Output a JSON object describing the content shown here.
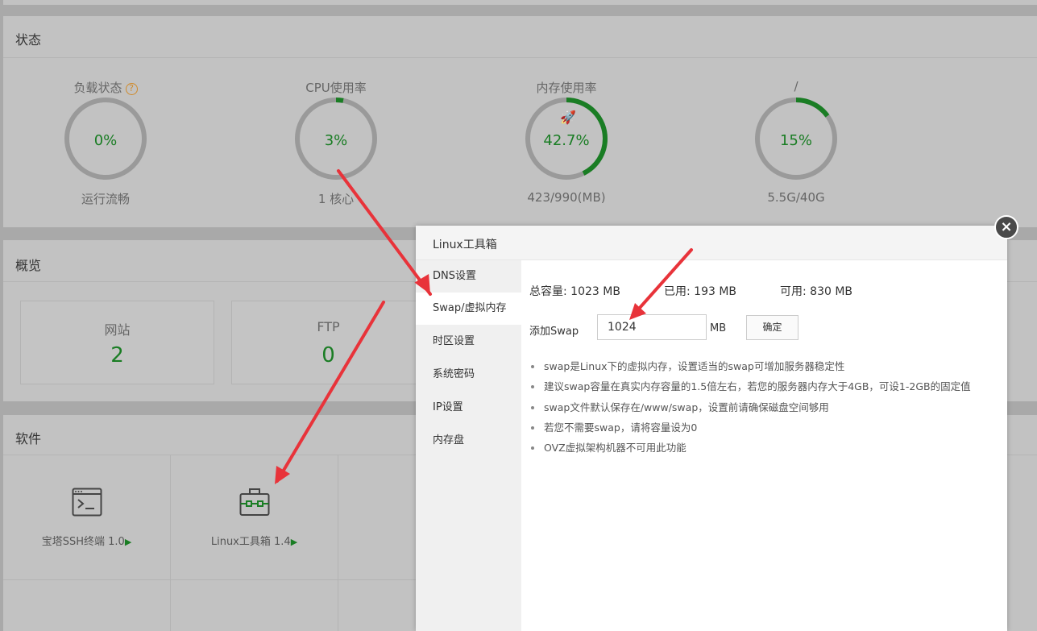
{
  "status_panel": {
    "title": "状态",
    "gauges": [
      {
        "title": "负载状态",
        "value": "0%",
        "sub": "运行流畅",
        "percent": 0,
        "has_help": true
      },
      {
        "title": "CPU使用率",
        "value": "3%",
        "sub": "1 核心",
        "percent": 3
      },
      {
        "title": "内存使用率",
        "value": "42.7%",
        "sub": "423/990(MB)",
        "percent": 42.7,
        "icon": "rocket-icon"
      },
      {
        "title": "/",
        "value": "15%",
        "sub": "5.5G/40G",
        "percent": 15
      }
    ],
    "help_symbol": "?"
  },
  "overview_panel": {
    "title": "概览",
    "cards": [
      {
        "label": "网站",
        "value": "2"
      },
      {
        "label": "FTP",
        "value": "0"
      }
    ]
  },
  "software_panel": {
    "title": "软件",
    "items": [
      {
        "label": "宝塔SSH终端 1.0",
        "icon": "terminal-icon"
      },
      {
        "label": "Linux工具箱 1.4",
        "icon": "toolbox-icon"
      }
    ],
    "play_symbol": "▶"
  },
  "dialog": {
    "title": "Linux工具箱",
    "close_symbol": "×",
    "nav": [
      "DNS设置",
      "Swap/虚拟内存",
      "时区设置",
      "系统密码",
      "IP设置",
      "内存盘"
    ],
    "active_nav": "Swap/虚拟内存",
    "stats": {
      "total": "总容量:  1023 MB",
      "used": "已用:  193 MB",
      "free": "可用:  830 MB"
    },
    "add_swap_label": "添加Swap",
    "swap_value": "1024",
    "unit": "MB",
    "confirm_label": "确定",
    "tips": [
      "swap是Linux下的虚拟内存，设置适当的swap可增加服务器稳定性",
      "建议swap容量在真实内存容量的1.5倍左右，若您的服务器内存大于4GB，可设1-2GB的固定值",
      "swap文件默认保存在/www/swap，设置前请确保磁盘空间够用",
      "若您不需要swap，请将容量设为0",
      "OVZ虚拟架构机器不可用此功能"
    ]
  },
  "colors": {
    "accent_green": "#1a7d24",
    "annotation_red": "#e8333a"
  }
}
